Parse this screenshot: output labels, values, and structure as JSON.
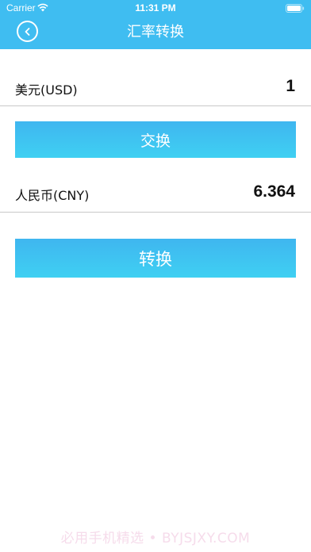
{
  "status_bar": {
    "carrier": "Carrier",
    "time": "11:31 PM"
  },
  "nav": {
    "title": "汇率转换"
  },
  "from_currency": {
    "label": "美元(USD)",
    "value": "1"
  },
  "swap_button": {
    "label": "交换"
  },
  "to_currency": {
    "label": "人民币(CNY)",
    "value": "6.364"
  },
  "convert_button": {
    "label": "转换"
  },
  "watermark": "必用手机精选 • BYJSJXY.COM",
  "colors": {
    "accent": "#3fbdf1",
    "button_gradient_top": "#3fb6f0",
    "button_gradient_bottom": "#3fd0f2"
  }
}
